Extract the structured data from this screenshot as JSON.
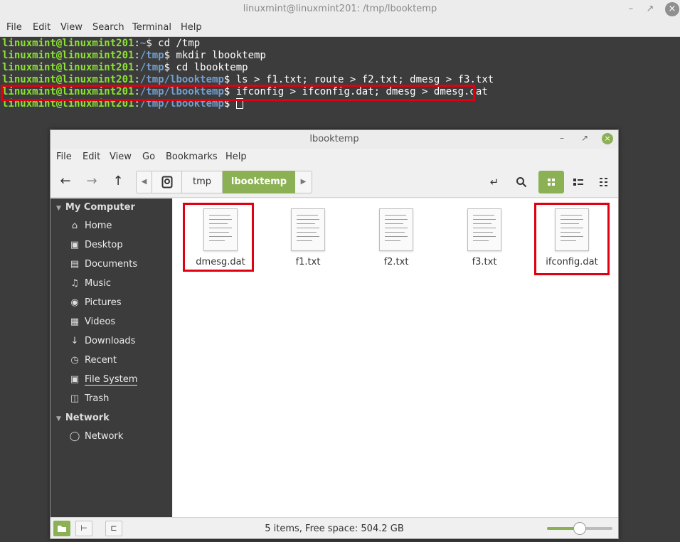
{
  "terminal": {
    "title": "linuxmint@linuxmint201: /tmp/lbooktemp",
    "menu": [
      "File",
      "Edit",
      "View",
      "Search",
      "Terminal",
      "Help"
    ],
    "lines": [
      {
        "user": "linuxmint@linuxmint201",
        "sep": ":",
        "path": "~",
        "prompt": "$ ",
        "cmd": "cd /tmp"
      },
      {
        "user": "linuxmint@linuxmint201",
        "sep": ":",
        "path": "/tmp",
        "prompt": "$ ",
        "cmd": "mkdir lbooktemp"
      },
      {
        "user": "linuxmint@linuxmint201",
        "sep": ":",
        "path": "/tmp",
        "prompt": "$ ",
        "cmd": "cd lbooktemp"
      },
      {
        "user": "linuxmint@linuxmint201",
        "sep": ":",
        "path": "/tmp/lbooktemp",
        "prompt": "$ ",
        "cmd": "ls > f1.txt; route > f2.txt; dmesg > f3.txt"
      },
      {
        "user": "linuxmint@linuxmint201",
        "sep": ":",
        "path": "/tmp/lbooktemp",
        "prompt": "$ ",
        "cmd": "ifconfig > ifconfig.dat; dmesg > dmesg.dat"
      },
      {
        "user": "linuxmint@linuxmint201",
        "sep": ":",
        "path": "/tmp/lbooktemp",
        "prompt": "$ ",
        "cmd": ""
      }
    ]
  },
  "file_manager": {
    "title": "lbooktemp",
    "menu": [
      "File",
      "Edit",
      "View",
      "Go",
      "Bookmarks",
      "Help"
    ],
    "breadcrumb": [
      "tmp",
      "lbooktemp"
    ],
    "sidebar": {
      "sections": [
        {
          "heading": "My Computer",
          "items": [
            {
              "label": "Home",
              "icon": "home-icon"
            },
            {
              "label": "Desktop",
              "icon": "desktop-icon"
            },
            {
              "label": "Documents",
              "icon": "documents-icon"
            },
            {
              "label": "Music",
              "icon": "music-icon"
            },
            {
              "label": "Pictures",
              "icon": "pictures-icon"
            },
            {
              "label": "Videos",
              "icon": "videos-icon"
            },
            {
              "label": "Downloads",
              "icon": "downloads-icon"
            },
            {
              "label": "Recent",
              "icon": "recent-icon"
            },
            {
              "label": "File System",
              "icon": "drive-icon"
            },
            {
              "label": "Trash",
              "icon": "trash-icon"
            }
          ]
        },
        {
          "heading": "Network",
          "items": [
            {
              "label": "Network",
              "icon": "network-icon"
            }
          ]
        }
      ]
    },
    "files": [
      {
        "name": "dmesg.dat",
        "highlighted": true
      },
      {
        "name": "f1.txt",
        "highlighted": false
      },
      {
        "name": "f2.txt",
        "highlighted": false
      },
      {
        "name": "f3.txt",
        "highlighted": false
      },
      {
        "name": "ifconfig.dat",
        "highlighted": true
      }
    ],
    "status": "5 items, Free space: 504.2 GB",
    "zoom_level": 0.5
  },
  "colors": {
    "accent": "#8cb155",
    "highlight": "#e0000f",
    "term_user": "#8ae234",
    "term_path": "#729fcf"
  }
}
